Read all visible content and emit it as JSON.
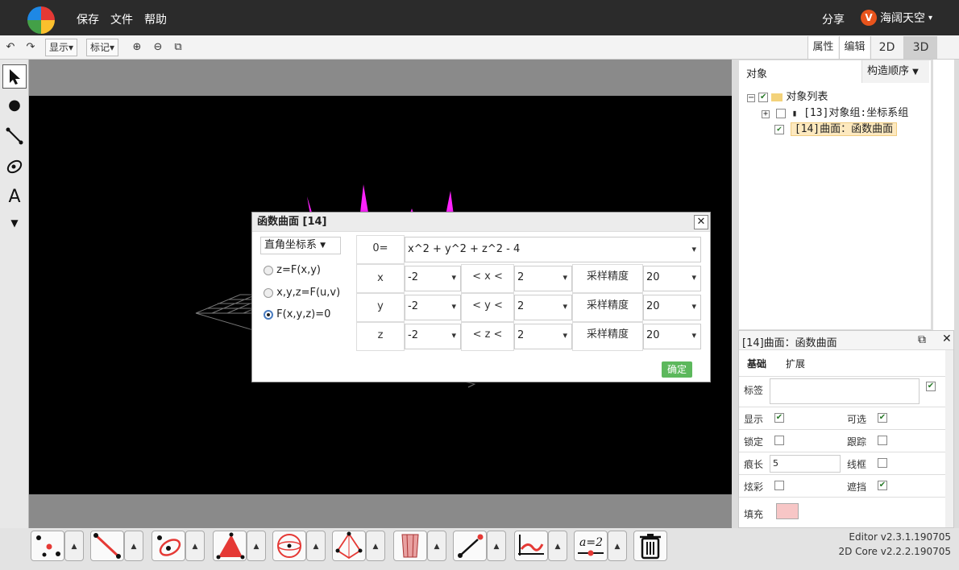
{
  "menu": {
    "save": "保存",
    "file": "文件",
    "help": "帮助",
    "share": "分享",
    "user": "海阔天空"
  },
  "toolbar": {
    "display": "显示",
    "mark": "标记",
    "attr_tab": "属性",
    "edit_tab": "编辑",
    "view_2d": "2D",
    "view_3d": "3D"
  },
  "left_tools": {
    "text_tool": "A"
  },
  "objects": {
    "tab_objects": "对象",
    "tab_order": "构造顺序",
    "root": "对象列表",
    "item1": "[13]对象组:坐标系组",
    "item2": "[14]曲面：函数曲面"
  },
  "props": {
    "title": "[14]曲面：函数曲面",
    "tab_basic": "基础",
    "tab_ext": "扩展",
    "label": "标签",
    "show": "显示",
    "selectable": "可选",
    "lock": "锁定",
    "trace": "跟踪",
    "trail_len": "痕长",
    "trail_val": "5",
    "wireframe": "线框",
    "glow": "炫彩",
    "occlude": "遮挡",
    "fill": "填充",
    "fill_color": "#f7c6c6"
  },
  "dialog": {
    "title": "函数曲面 [14]",
    "coord": "直角坐标系",
    "opt1": "z=F(x,y)",
    "opt2": "x,y,z=F(u,v)",
    "opt3": "F(x,y,z)=0",
    "eq_label": "0=",
    "equation": "x^2 + y^2 + z^2 - 4",
    "rows": [
      {
        "var": "x",
        "min": "-2",
        "cmp": "< x <",
        "max": "2",
        "prec_label": "采样精度",
        "prec": "20"
      },
      {
        "var": "y",
        "min": "-2",
        "cmp": "< y <",
        "max": "2",
        "prec_label": "采样精度",
        "prec": "20"
      },
      {
        "var": "z",
        "min": "-2",
        "cmp": "< z <",
        "max": "2",
        "prec_label": "采样精度",
        "prec": "20"
      }
    ],
    "ok": "确定"
  },
  "version": {
    "editor": "Editor v2.3.1.190705",
    "core": "2D Core v2.2.2.190705"
  },
  "colors": {
    "spike": "#ff22ff",
    "accent_green": "#5cb85c",
    "topbar": "#2b2b2b"
  }
}
